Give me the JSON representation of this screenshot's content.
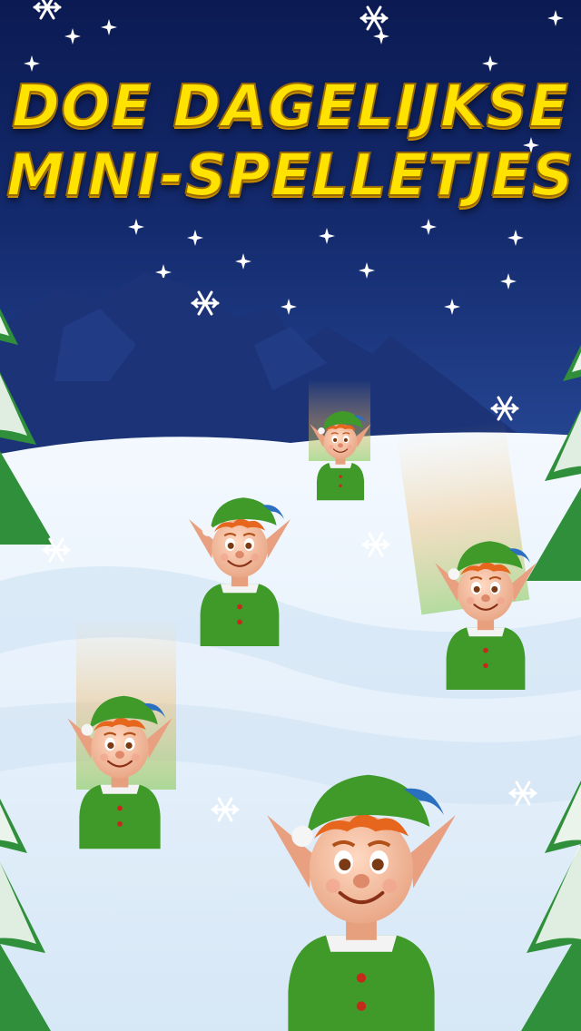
{
  "headline": {
    "line1": "DOE DAGELIJKSE",
    "line2": "MINI-SPELLETJES"
  },
  "colors": {
    "sky_top": "#0b1a52",
    "sky_bottom": "#2a4c9c",
    "mountain": "#1c3477",
    "snow": "#e8f2fb",
    "title_yellow": "#ffe200",
    "elf_hat_green": "#3f9a2a",
    "elf_hair": "#e5661c",
    "tree_green": "#2f8f3a"
  },
  "elf_count": 5
}
